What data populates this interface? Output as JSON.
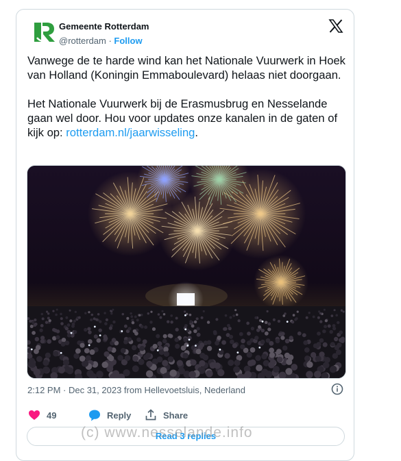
{
  "account": {
    "name": "Gemeente Rotterdam",
    "handle": "@rotterdam",
    "separator": "·",
    "follow_label": "Follow",
    "avatar_icon": "rotterdam-r-logo-icon",
    "brand_color": "#2f9e3f"
  },
  "platform_icon": "x-logo-icon",
  "tweet": {
    "paragraph1": "Vanwege de te harde wind kan het Nationale Vuurwerk in Hoek van Holland (Koningin Emmaboulevard) helaas niet doorgaan.",
    "paragraph2": "Het Nationale Vuurwerk bij de Erasmusbrug en Nesselande gaan wel door. Hou voor updates onze kanalen in de gaten of kijk op: ",
    "link": "rotterdam.nl/jaarwisseling",
    "link_suffix": ".",
    "link_color": "#1d9bf0"
  },
  "meta": {
    "timestamp": "2:12 PM · Dec 31, 2023 from Hellevoetsluis, Nederland",
    "info_icon": "info-icon"
  },
  "actions": {
    "like_count": "49",
    "like_icon": "heart-icon",
    "like_color": "#f91880",
    "reply_label": "Reply",
    "reply_icon": "reply-bubble-icon",
    "share_label": "Share",
    "share_icon": "share-upload-icon"
  },
  "read_replies_label": "Read 3 replies",
  "watermark": "(c)  www.nesselande.info"
}
